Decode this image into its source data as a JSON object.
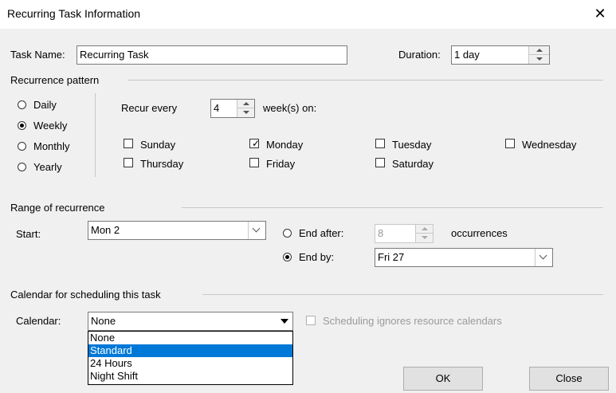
{
  "window": {
    "title": "Recurring Task Information"
  },
  "task": {
    "name_label": "Task Name:",
    "name_value": "Recurring Task",
    "duration_label": "Duration:",
    "duration_value": "1 day"
  },
  "recurrence": {
    "group_label": "Recurrence pattern",
    "options": [
      "Daily",
      "Weekly",
      "Monthly",
      "Yearly"
    ],
    "selected": "Weekly",
    "recur_every_label": "Recur every",
    "recur_every_value": "4",
    "weeks_on_label": "week(s) on:",
    "days": [
      {
        "label": "Sunday",
        "checked": false
      },
      {
        "label": "Monday",
        "checked": true
      },
      {
        "label": "Tuesday",
        "checked": false
      },
      {
        "label": "Wednesday",
        "checked": false
      },
      {
        "label": "Thursday",
        "checked": false
      },
      {
        "label": "Friday",
        "checked": false
      },
      {
        "label": "Saturday",
        "checked": false
      }
    ]
  },
  "range": {
    "group_label": "Range of recurrence",
    "start_label": "Start:",
    "start_value": "Mon 2",
    "end_after_label": "End after:",
    "end_after_value": "8",
    "occurrences_label": "occurrences",
    "end_by_label": "End by:",
    "end_by_value": "Fri 27",
    "selected": "End by"
  },
  "calendar": {
    "group_label": "Calendar for scheduling this task",
    "calendar_label": "Calendar:",
    "calendar_value": "None",
    "ignore_label": "Scheduling ignores resource calendars",
    "options": [
      "None",
      "Standard",
      "24 Hours",
      "Night Shift"
    ],
    "highlighted": "Standard"
  },
  "buttons": {
    "ok": "OK",
    "close": "Close"
  },
  "colors": {
    "highlight": "#0078d7"
  }
}
